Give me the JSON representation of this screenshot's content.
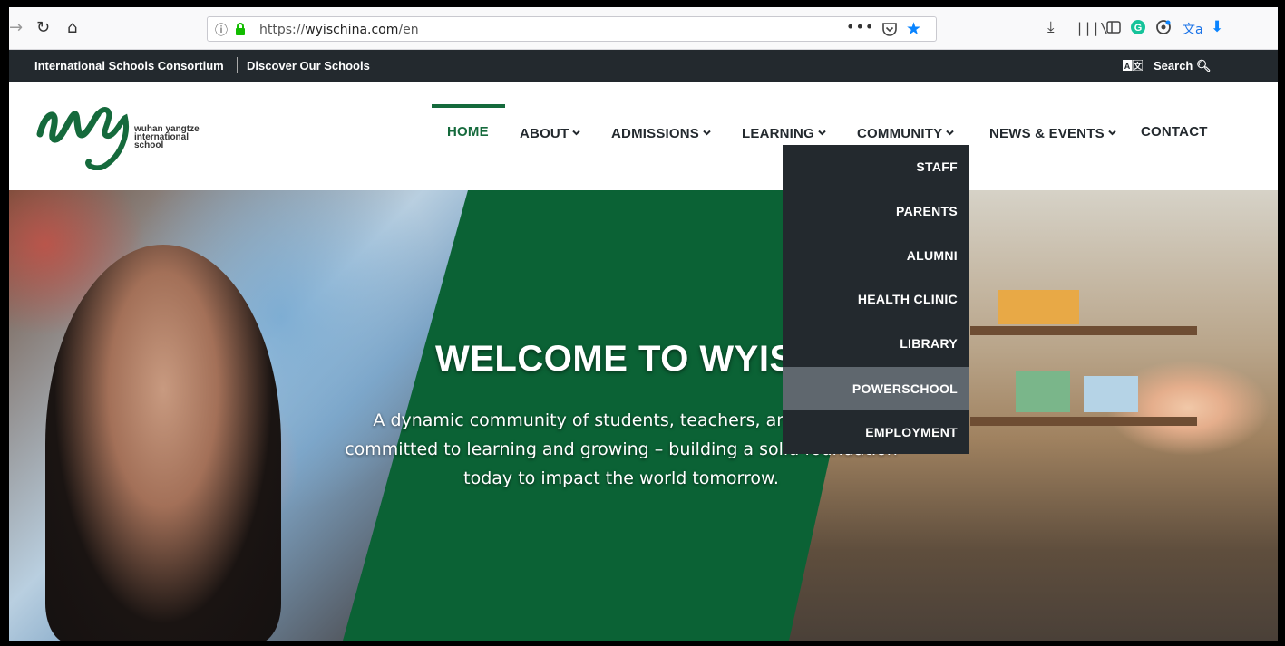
{
  "browser": {
    "url_scheme": "https://",
    "url_host": "wyischina.com",
    "url_path": "/en",
    "page_actions": "•••"
  },
  "top_bar": {
    "consortium": "International Schools Consortium",
    "discover": "Discover Our Schools",
    "search": "Search"
  },
  "logo": {
    "line1": "wuhan yangtze",
    "line2": "international",
    "line3": "school"
  },
  "nav": {
    "home": "HOME",
    "about": "ABOUT",
    "admissions": "ADMISSIONS",
    "learning": "LEARNING",
    "community": "COMMUNITY",
    "news": "NEWS & EVENTS",
    "contact": "CONTACT"
  },
  "community_menu": [
    {
      "label": "STAFF"
    },
    {
      "label": "PARENTS"
    },
    {
      "label": "ALUMNI"
    },
    {
      "label": "HEALTH CLINIC"
    },
    {
      "label": "LIBRARY"
    },
    {
      "label": "POWERSCHOOL"
    },
    {
      "label": "EMPLOYMENT"
    }
  ],
  "hero": {
    "heading": "WELCOME TO WYIS",
    "line1": "A dynamic community of students, teachers, and parents",
    "line2": "committed to learning and growing – building a solid foundation",
    "line3": "today to impact the world tomorrow."
  },
  "colors": {
    "brand_green": "#156a3c",
    "panel_green": "#0b6235",
    "dark": "#23292e",
    "dropdown_hover": "#5f676e",
    "firefox_blue": "#0a84ff"
  }
}
